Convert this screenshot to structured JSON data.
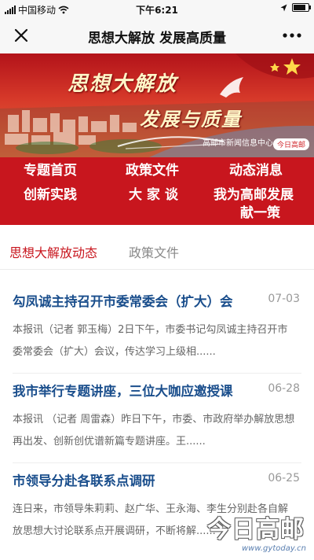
{
  "status_bar": {
    "carrier": "中国移动",
    "time": "下午6:21",
    "battery_level": 0.85
  },
  "nav": {
    "title": "思想大解放 发展高质量",
    "close_icon": "close-icon",
    "more_icon": "more-icon"
  },
  "banner": {
    "slogan_line1": "思想大解放",
    "slogan_line2": "发展与质量",
    "credit": "高邮市新闻信息中心",
    "logo_text": "今日高邮"
  },
  "menu": {
    "items": [
      {
        "label": "专题首页"
      },
      {
        "label": "政策文件"
      },
      {
        "label": "动态消息"
      },
      {
        "label": "创新实践"
      },
      {
        "label": "大 家 谈"
      },
      {
        "label": "我为高邮发展"
      },
      {
        "label": "献一策"
      }
    ]
  },
  "tabs": [
    {
      "label": "思想大解放动态",
      "active": true
    },
    {
      "label": "政策文件",
      "active": false
    }
  ],
  "articles": [
    {
      "headline": "勾凤诚主持召开市委常委会（扩大）会",
      "date": "07-03",
      "summary": "本报讯（记者 郭玉梅）2日下午，市委书记勾凤诚主持召开市委常委会（扩大）会议，传达学习上级相......"
    },
    {
      "headline": "我市举行专题讲座，三位大咖应邀授课",
      "date": "06-28",
      "summary": "本报讯 （记者 周雷森）昨日下午，市委、市政府举办解放思想再出发、创新创优谱新篇专题讲座。王......"
    },
    {
      "headline": "市领导分赴各联系点调研",
      "date": "06-25",
      "summary": "连日来，市领导朱莉莉、赵广华、王永海、李生分别赴各自解放思想大讨论联系点开展调研，不断将解......"
    }
  ],
  "watermark": {
    "brand": "今日高邮",
    "url": "www.gytoday.cn"
  },
  "colors": {
    "brand_red": "#c8161e",
    "headline_blue": "#1a4e8c"
  }
}
